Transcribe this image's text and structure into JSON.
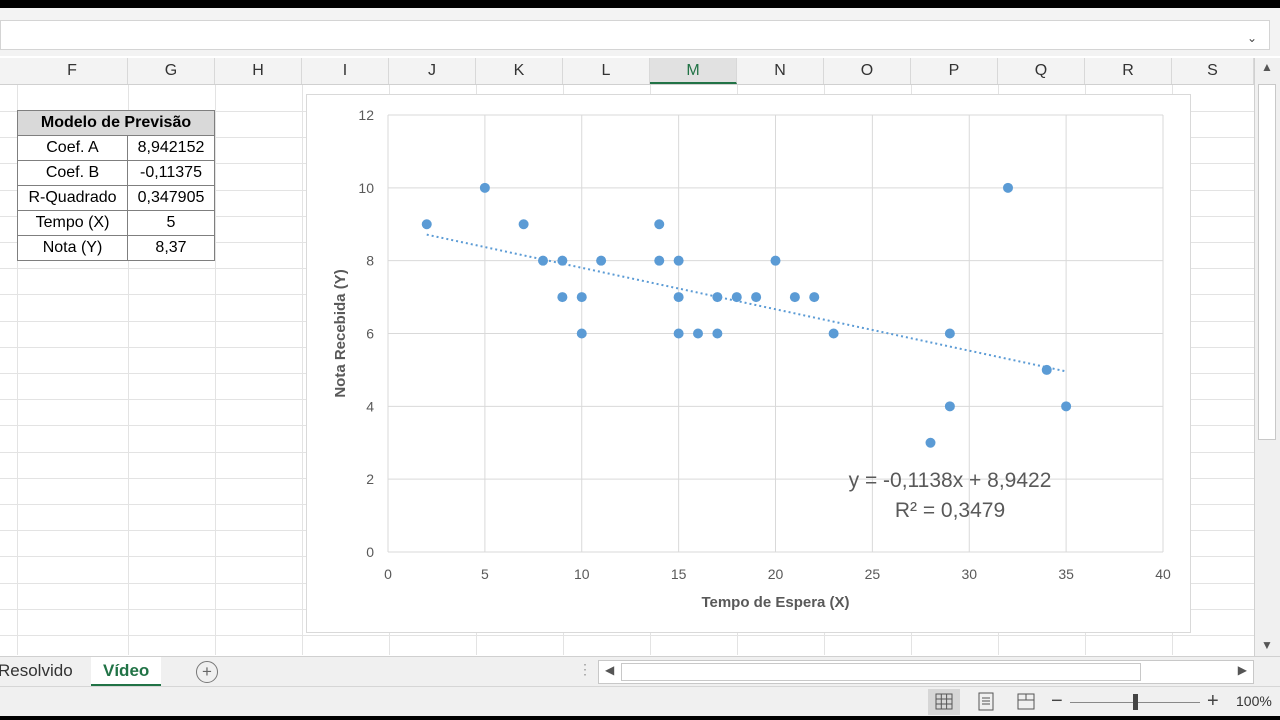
{
  "columns": [
    "F",
    "G",
    "H",
    "I",
    "J",
    "K",
    "L",
    "M",
    "N",
    "O",
    "P",
    "Q",
    "R",
    "S"
  ],
  "selected_column": "M",
  "model_table": {
    "title": "Modelo de Previsão",
    "rows": [
      {
        "label": "Coef. A",
        "value": "8,942152"
      },
      {
        "label": "Coef. B",
        "value": "-0,11375"
      },
      {
        "label": "R-Quadrado",
        "value": "0,347905"
      },
      {
        "label": "Tempo (X)",
        "value": "5"
      },
      {
        "label": "Nota (Y)",
        "value": "8,37"
      }
    ]
  },
  "chart_data": {
    "type": "scatter",
    "xlabel": "Tempo de Espera (X)",
    "ylabel": "Nota Recebida (Y)",
    "xlim": [
      0,
      40
    ],
    "ylim": [
      0,
      12
    ],
    "xticks": [
      0,
      5,
      10,
      15,
      20,
      25,
      30,
      35,
      40
    ],
    "yticks": [
      0,
      2,
      4,
      6,
      8,
      10,
      12
    ],
    "grid": true,
    "color": "#5b9bd5",
    "points": [
      [
        2,
        9
      ],
      [
        5,
        10
      ],
      [
        7,
        9
      ],
      [
        8,
        8
      ],
      [
        9,
        8
      ],
      [
        9,
        7
      ],
      [
        10,
        7
      ],
      [
        10,
        6
      ],
      [
        11,
        8
      ],
      [
        14,
        9
      ],
      [
        14,
        8
      ],
      [
        15,
        8
      ],
      [
        15,
        7
      ],
      [
        15,
        6
      ],
      [
        16,
        6
      ],
      [
        17,
        7
      ],
      [
        17,
        6
      ],
      [
        18,
        7
      ],
      [
        19,
        7
      ],
      [
        20,
        8
      ],
      [
        21,
        7
      ],
      [
        22,
        7
      ],
      [
        23,
        6
      ],
      [
        28,
        3
      ],
      [
        29,
        6
      ],
      [
        29,
        4
      ],
      [
        32,
        10
      ],
      [
        34,
        5
      ],
      [
        35,
        4
      ]
    ],
    "trendline": {
      "slope": -0.1138,
      "intercept": 8.9422,
      "x_range": [
        2,
        35
      ],
      "equation": "y = -0,1138x + 8,9422",
      "r_squared": "R² = 0,3479"
    }
  },
  "sheet_tabs": [
    {
      "label": "Resolvido",
      "active": false
    },
    {
      "label": "Vídeo",
      "active": true
    }
  ],
  "status": {
    "zoom": "100%"
  },
  "icons": {
    "add_sheet": "plus-circle-icon",
    "normal_view": "grid-view-icon",
    "page_layout": "page-layout-icon",
    "page_break": "page-break-icon"
  }
}
